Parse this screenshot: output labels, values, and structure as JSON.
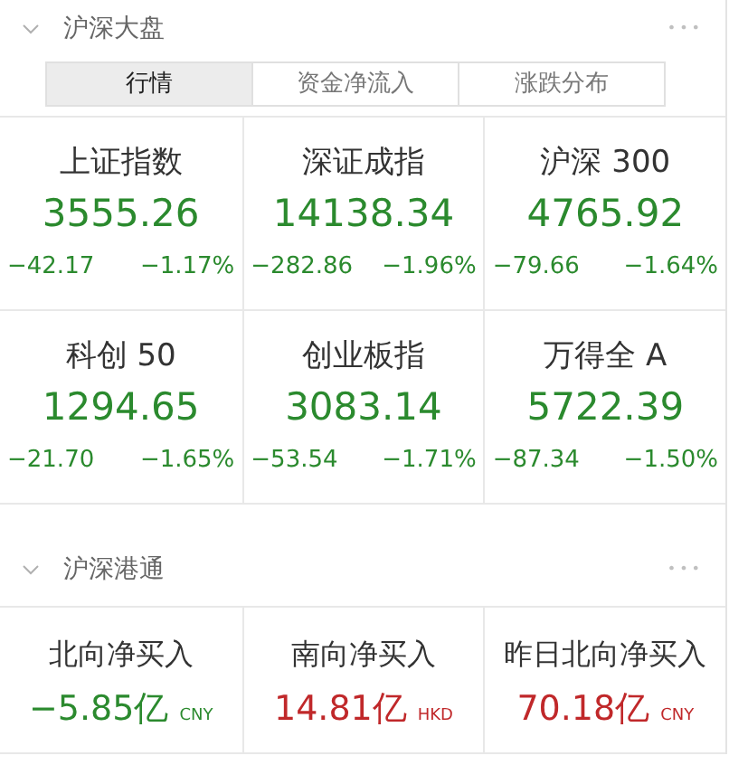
{
  "market": {
    "title": "沪深大盘",
    "menu": "•••",
    "tabs": [
      {
        "label": "行情",
        "selected": true
      },
      {
        "label": "资金净流入",
        "selected": false
      },
      {
        "label": "涨跌分布",
        "selected": false
      }
    ],
    "indices": [
      {
        "name": "上证指数",
        "value": "3555.26",
        "change": "−42.17",
        "percent": "−1.17%",
        "color": "#2b8a2e"
      },
      {
        "name": "深证成指",
        "value": "14138.34",
        "change": "−282.86",
        "percent": "−1.96%",
        "color": "#2b8a2e"
      },
      {
        "name": "沪深 300",
        "value": "4765.92",
        "change": "−79.66",
        "percent": "−1.64%",
        "color": "#2b8a2e"
      },
      {
        "name": "科创 50",
        "value": "1294.65",
        "change": "−21.70",
        "percent": "−1.65%",
        "color": "#2b8a2e"
      },
      {
        "name": "创业板指",
        "value": "3083.14",
        "change": "−53.54",
        "percent": "−1.71%",
        "color": "#2b8a2e"
      },
      {
        "name": "万得全 A",
        "value": "5722.39",
        "change": "−87.34",
        "percent": "−1.50%",
        "color": "#2b8a2e"
      }
    ]
  },
  "connect": {
    "title": "沪深港通",
    "menu": "•••",
    "flows": [
      {
        "name": "北向净买入",
        "value": "−5.85亿",
        "currency": "CNY",
        "color": "#2b8a2e"
      },
      {
        "name": "南向净买入",
        "value": "14.81亿",
        "currency": "HKD",
        "color": "#c0282a"
      },
      {
        "name": "昨日北向净买入",
        "value": "70.18亿",
        "currency": "CNY",
        "color": "#c0282a"
      }
    ]
  }
}
